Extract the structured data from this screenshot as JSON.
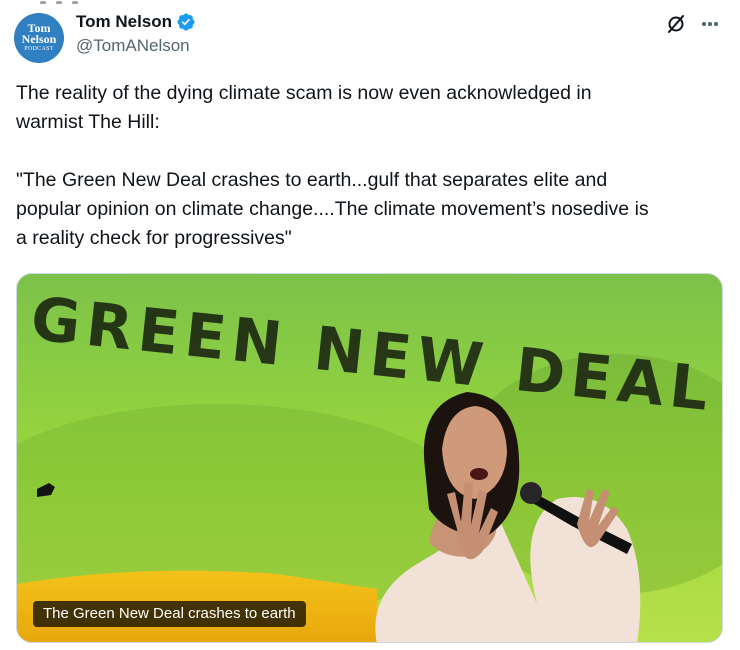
{
  "author": {
    "display_name": "Tom Nelson",
    "handle": "@TomANelson",
    "verified": true,
    "avatar_text": [
      "Tom",
      "Nelson",
      "PODCAST"
    ]
  },
  "tweet": {
    "paragraph_1": "The reality of the dying climate scam is now even acknowledged in\nwarmist The Hill:",
    "paragraph_2": "\"The Green New Deal crashes to earth...gulf that separates elite and\npopular opinion on climate change....The climate movement’s nosedive is\na reality check for progressives\""
  },
  "media": {
    "banner_text": "GREEN NEW DEAL",
    "caption": "The Green New Deal crashes to earth"
  },
  "icons": {
    "verified": "verified-badge-icon",
    "grok": "grok-icon",
    "more": "more-icon"
  },
  "colors": {
    "verified_blue": "#1d9bf0",
    "avatar_blue": "#2f7fc1",
    "text": "#0f1419",
    "secondary": "#536471",
    "banner_green": "#8fcf3a"
  }
}
